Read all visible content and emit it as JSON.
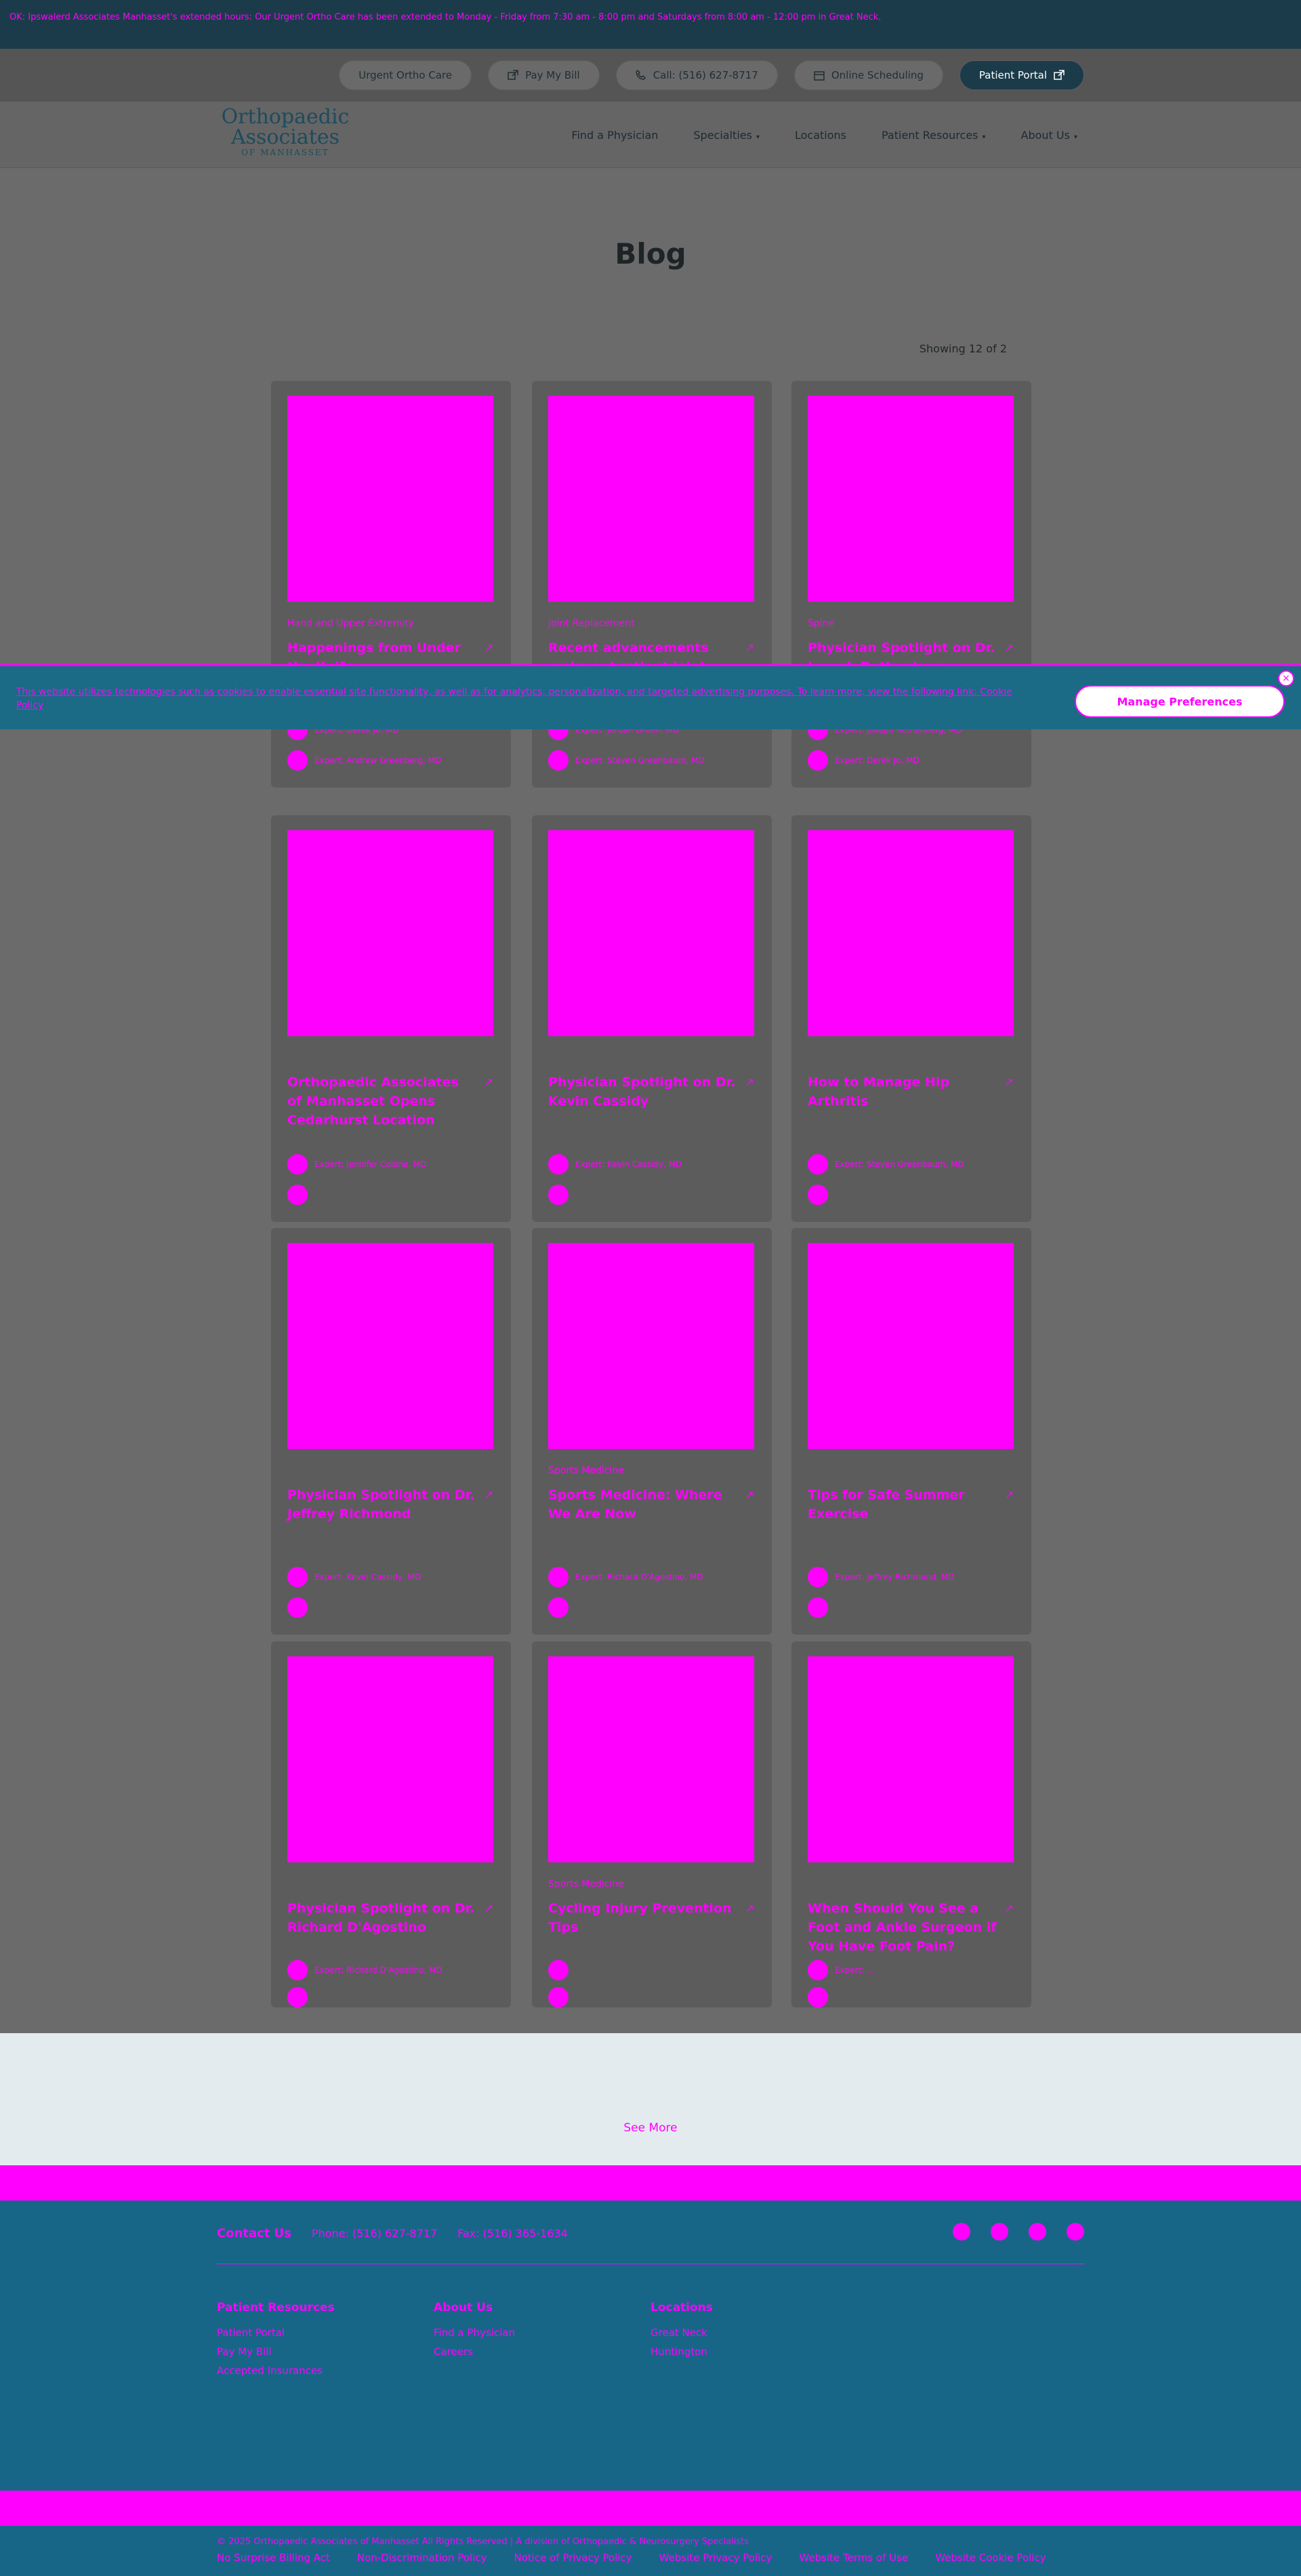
{
  "announcement": {
    "text": "OK: Ipswalerd Associates Manhasset's extended hours: Our Urgent Ortho Care has been extended to Monday - Friday from 7:30 am - 8:00 pm and Saturdays from 8:00 am - 12:00 pm in Great Neck."
  },
  "utility": {
    "urgent": "Urgent Ortho Care",
    "pay": "Pay My Bill",
    "call": "Call: (516) 627-8717",
    "scheduling": "Online Scheduling",
    "portal": "Patient Portal"
  },
  "nav": {
    "logo_line1": "Orthopaedic",
    "logo_line2": "Associates",
    "logo_line3": "OF MANHASSET",
    "items": [
      "Find a Physician",
      "Specialties",
      "Locations",
      "Patient Resources",
      "About Us"
    ]
  },
  "page": {
    "title": "Blog",
    "showing": "Showing 12 of 2"
  },
  "cards": [
    {
      "category": "Hand and Upper Extremity",
      "title": "Happenings from Under the Knife",
      "expert1": "Expert: Derek Jo, MD",
      "expert2": "Expert: Andrew Greenberg, MD"
    },
    {
      "category": "Joint Replacement",
      "title": "Recent advancements make outpatient joint replacement safe and effective",
      "expert1": "Expert: Jordan Gruen, MD",
      "expert2": "Expert: Steven Greenbaum, MD"
    },
    {
      "category": "Spine",
      "title": "Physician Spotlight on Dr. Joseph Rothenberg",
      "expert1": "Expert: Joseph Rothenberg, MD",
      "expert2": "Expert: Derek Jo, MD"
    },
    {
      "category": "",
      "title": "Orthopaedic Associates of Manhasset Opens Cedarhurst Location",
      "expert1": "Expert: Jennifer Colone, MD",
      "expert2": ""
    },
    {
      "category": "",
      "title": "Physician Spotlight on Dr. Kevin Cassidy",
      "expert1": "Expert: Kevin Cassidy, MD",
      "expert2": ""
    },
    {
      "category": "",
      "title": "How to Manage Hip Arthritis",
      "expert1": "Expert: Steven Greenbaum, MD",
      "expert2": ""
    },
    {
      "category": "",
      "title": "Physician Spotlight on Dr. Jeffrey Richmond",
      "expert1": "Expert: Kevin Cassidy, MD",
      "expert2": ""
    },
    {
      "category": "Sports Medicine",
      "title": "Sports Medicine: Where We Are Now",
      "expert1": "Expert: Richard D'Agostino, MD",
      "expert2": ""
    },
    {
      "category": "",
      "title": "Tips for Safe Summer Exercise",
      "expert1": "Expert: Jeffrey Richmond, MD",
      "expert2": ""
    },
    {
      "category": "",
      "title": "Physician Spotlight on Dr. Richard D'Agostino",
      "expert1": "Expert: Richard D'Agostino, MD",
      "expert2": ""
    },
    {
      "category": "Sports Medicine",
      "title": "Cycling Injury Prevention Tips",
      "expert1": "",
      "expert2": ""
    },
    {
      "category": "",
      "title": "When Should You See a Foot and Ankle Surgeon if You Have Foot Pain?",
      "expert1": "Expert: ...",
      "expert2": ""
    }
  ],
  "cookie": {
    "text": "This website utilizes technologies such as cookies to enable essential site functionality, as well as for analytics, personalization, and targeted advertising purposes. To learn more, view the following link: Cookie Policy",
    "button": "Manage Preferences",
    "close": "×"
  },
  "see_more": "See More",
  "footer": {
    "contact_label": "Contact Us",
    "phone": "Phone: (516) 627-8717",
    "fax": "Fax: (516) 365-1634",
    "col1_title": "Patient Resources",
    "col1": [
      "Patient Portal",
      "Pay My Bill",
      "Accepted Insurances"
    ],
    "col2_title": "About Us",
    "col2": [
      "Find a Physician",
      "Careers"
    ],
    "col3_title": "Locations",
    "col3": [
      "Great Neck",
      "Huntington"
    ],
    "copyright": "© 2025 Orthopaedic Associates of Manhasset All Rights Reserved | A division of Orthopaedic & Neurosurgery Specialists",
    "links": [
      "No Surprise Billing Act",
      "Non-Discrimination Policy",
      "Notice of Privacy Policy",
      "Website Privacy Policy",
      "Website Terms of Use",
      "Website Cookie Policy"
    ]
  }
}
